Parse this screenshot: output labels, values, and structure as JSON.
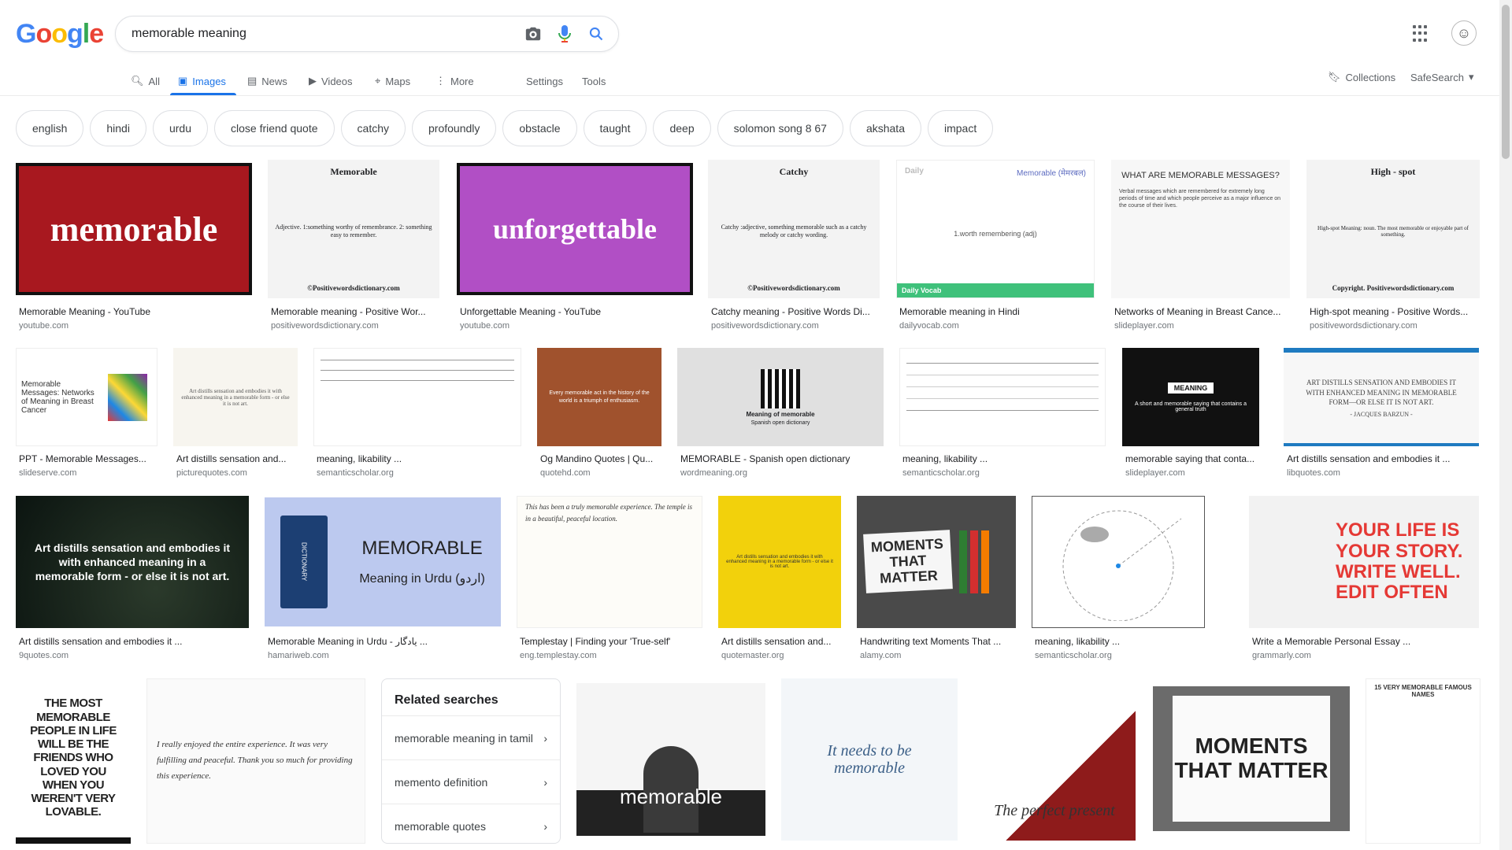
{
  "header": {
    "logo": "Google",
    "query": "memorable meaning"
  },
  "tabs": [
    {
      "label": "All",
      "icon": "search-icon"
    },
    {
      "label": "Images",
      "icon": "image-icon"
    },
    {
      "label": "News",
      "icon": "news-icon"
    },
    {
      "label": "Videos",
      "icon": "video-icon"
    },
    {
      "label": "Maps",
      "icon": "map-icon"
    },
    {
      "label": "More",
      "icon": "more-vert-icon"
    }
  ],
  "settings_label": "Settings",
  "tools_label": "Tools",
  "collections_label": "Collections",
  "safesearch_label": "SafeSearch",
  "chips": [
    "english",
    "hindi",
    "urdu",
    "close friend quote",
    "catchy",
    "profoundly",
    "obstacle",
    "taught",
    "deep",
    "solomon song 8 67",
    "akshata",
    "impact"
  ],
  "results": [
    {
      "caption": "Memorable Meaning - YouTube",
      "domain": "youtube.com",
      "thumb_text": "memorable"
    },
    {
      "caption": "Memorable meaning - Positive Wor...",
      "domain": "positivewordsdictionary.com",
      "thumb_title": "Memorable",
      "thumb_text": "Adjective. 1:something worthy of remembrance. 2: something easy to remember.",
      "thumb_footer": "©Positivewordsdictionary.com"
    },
    {
      "caption": "Unforgettable Meaning - YouTube",
      "domain": "youtube.com",
      "thumb_text": "unforgettable"
    },
    {
      "caption": "Catchy meaning - Positive Words Di...",
      "domain": "positivewordsdictionary.com",
      "thumb_title": "Catchy",
      "thumb_text": "Catchy :adjective, something memorable such as a catchy melody or catchy wording.",
      "thumb_footer": "©Positivewordsdictionary.com"
    },
    {
      "caption": "Memorable meaning in Hindi",
      "domain": "dailyvocab.com",
      "thumb_title": "Memorable (मेमरबल)",
      "thumb_text": "1.worth remembering (adj)",
      "thumb_footer": "Daily Vocab"
    },
    {
      "caption": "Networks of Meaning in Breast Cance...",
      "domain": "slideplayer.com",
      "thumb_title": "WHAT ARE MEMORABLE MESSAGES?",
      "thumb_text": "Verbal messages which are remembered for extremely long periods of time and which people perceive as a major influence on the course of their lives."
    },
    {
      "caption": "High-spot meaning - Positive Words...",
      "domain": "positivewordsdictionary.com",
      "thumb_title": "High - spot",
      "thumb_text": "High-spot Meaning: noun. The most memorable or enjoyable part of something.",
      "thumb_footer": "Copyright. Positivewordsdictionary.com"
    },
    {
      "caption": "PPT - Memorable Messages...",
      "domain": "slideserve.com",
      "thumb_title": "Memorable Messages: Networks of Meaning in Breast Cancer"
    },
    {
      "caption": "Art distills sensation and...",
      "domain": "picturequotes.com",
      "thumb_text": "Art distills sensation and embodies it with enhanced meaning in a memorable form - or else it is not art."
    },
    {
      "caption": "meaning, likability ...",
      "domain": "semanticscholar.org"
    },
    {
      "caption": "Og Mandino Quotes | Qu...",
      "domain": "quotehd.com",
      "thumb_text": "Every memorable act in the history of the world is a triumph of enthusiasm."
    },
    {
      "caption": "MEMORABLE - Spanish open dictionary",
      "domain": "wordmeaning.org",
      "thumb_title": "Meaning of memorable",
      "thumb_text": "Spanish open dictionary"
    },
    {
      "caption": "meaning, likability ...",
      "domain": "semanticscholar.org"
    },
    {
      "caption": "memorable saying that conta...",
      "domain": "slideplayer.com",
      "thumb_title": "MEANING",
      "thumb_text": "A short and memorable saying that contains a general truth"
    },
    {
      "caption": "Art distills sensation and embodies it ...",
      "domain": "libquotes.com",
      "thumb_text": "ART DISTILLS SENSATION AND EMBODIES IT WITH ENHANCED MEANING IN MEMORABLE FORM—OR ELSE IT IS NOT ART.",
      "thumb_footer": "- JACQUES BARZUN -"
    },
    {
      "caption": "Art distills sensation and embodies it ...",
      "domain": "9quotes.com",
      "thumb_text": "Art distills sensation and embodies it with enhanced meaning in a memorable form - or else it is not art."
    },
    {
      "caption": "Memorable Meaning in Urdu - یادگار ...",
      "domain": "hamariweb.com",
      "thumb_title": "MEMORABLE",
      "thumb_text": "Meaning in Urdu (اردو)"
    },
    {
      "caption": "Templestay | Finding your 'True-self'",
      "domain": "eng.templestay.com",
      "thumb_text": "This has been a truly memorable experience. The temple is in a beautiful, peaceful location."
    },
    {
      "caption": "Art distills sensation and...",
      "domain": "quotemaster.org",
      "thumb_text": "Art distills sensation and embodies it with enhanced meaning in a memorable form - or else it is not art."
    },
    {
      "caption": "Handwriting text Moments That ...",
      "domain": "alamy.com",
      "thumb_text": "MOMENTS THAT MATTER"
    },
    {
      "caption": "meaning, likability ...",
      "domain": "semanticscholar.org"
    },
    {
      "caption": "Write a Memorable Personal Essay ...",
      "domain": "grammarly.com",
      "thumb_text": "YOUR LIFE IS YOUR STORY. WRITE WELL. EDIT OFTEN"
    }
  ],
  "row4": [
    {
      "thumb_text": "THE MOST MEMORABLE PEOPLE IN LIFE WILL BE THE FRIENDS WHO LOVED YOU WHEN YOU WEREN'T VERY LOVABLE."
    },
    {
      "thumb_text": "I really enjoyed the entire experience. It was very fulfilling and peaceful. Thank you so much for providing this experience."
    },
    {
      "thumb_text": "memorable"
    },
    {
      "thumb_text": "It needs to be memorable"
    },
    {
      "thumb_text": "The perfect present"
    },
    {
      "thumb_text": "MOMENTS THAT MATTER"
    },
    {
      "thumb_text": "15 VERY MEMORABLE FAMOUS NAMES"
    }
  ],
  "related": {
    "title": "Related searches",
    "items": [
      "memorable meaning in tamil",
      "memento definition",
      "memorable quotes"
    ]
  }
}
